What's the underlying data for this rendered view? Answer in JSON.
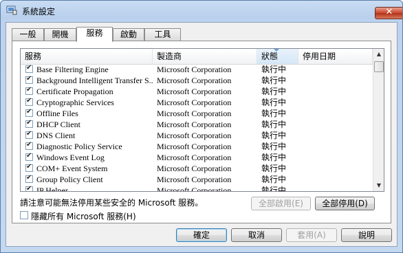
{
  "window": {
    "title": "系統設定"
  },
  "tabs": [
    {
      "label": "一般"
    },
    {
      "label": "開機"
    },
    {
      "label": "服務"
    },
    {
      "label": "啟動"
    },
    {
      "label": "工具"
    }
  ],
  "columns": {
    "service": "服務",
    "maker": "製造商",
    "status": "狀態",
    "disabled_date": "停用日期"
  },
  "rows": [
    {
      "name": "Base Filtering Engine",
      "maker": "Microsoft Corporation",
      "status": "執行中"
    },
    {
      "name": "Background Intelligent Transfer S...",
      "maker": "Microsoft Corporation",
      "status": "執行中"
    },
    {
      "name": "Certificate Propagation",
      "maker": "Microsoft Corporation",
      "status": "執行中"
    },
    {
      "name": "Cryptographic Services",
      "maker": "Microsoft Corporation",
      "status": "執行中"
    },
    {
      "name": "Offline Files",
      "maker": "Microsoft Corporation",
      "status": "執行中"
    },
    {
      "name": "DHCP Client",
      "maker": "Microsoft Corporation",
      "status": "執行中"
    },
    {
      "name": "DNS Client",
      "maker": "Microsoft Corporation",
      "status": "執行中"
    },
    {
      "name": "Diagnostic Policy Service",
      "maker": "Microsoft Corporation",
      "status": "執行中"
    },
    {
      "name": "Windows Event Log",
      "maker": "Microsoft Corporation",
      "status": "執行中"
    },
    {
      "name": "COM+ Event System",
      "maker": "Microsoft Corporation",
      "status": "執行中"
    },
    {
      "name": "Group Policy Client",
      "maker": "Microsoft Corporation",
      "status": "執行中"
    },
    {
      "name": "IP Helper",
      "maker": "Microsoft Corporation",
      "status": "執行中"
    }
  ],
  "note": "請注意可能無法停用某些安全的 Microsoft 服務。",
  "buttons": {
    "enable_all": "全部啟用(E)",
    "disable_all": "全部停用(D)",
    "ok": "確定",
    "cancel": "取消",
    "apply": "套用(A)",
    "help": "說明"
  },
  "hide_ms": {
    "label": "隱藏所有 Microsoft 服務(H)",
    "checked": false
  },
  "icons": {
    "app": "system-config-icon",
    "close": "close-icon",
    "scroll_up": "scroll-up-icon",
    "scroll_down": "scroll-down-icon"
  }
}
